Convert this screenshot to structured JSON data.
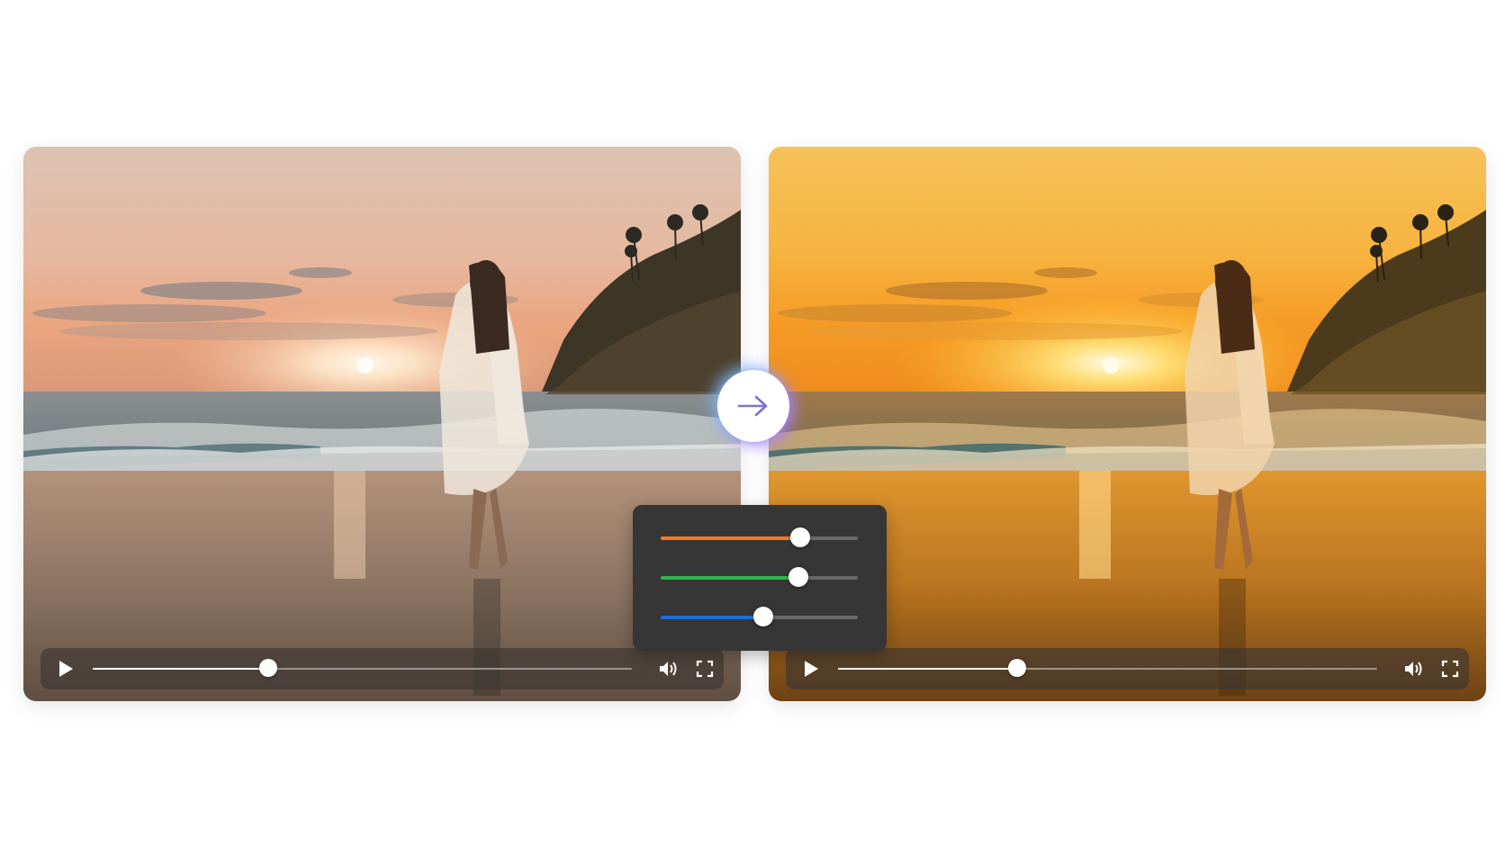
{
  "colors": {
    "accent_arrow": "#7b72d6",
    "slider_orange": "#f47a1f",
    "slider_green": "#2fb54a",
    "slider_blue": "#1d6fd8",
    "controls_bg": "#3a3632"
  },
  "before_player": {
    "progress": 0.326,
    "icons": {
      "play": "play-icon",
      "volume": "volume-icon",
      "fullscreen": "fullscreen-icon"
    }
  },
  "after_player": {
    "progress": 0.332,
    "icons": {
      "play": "play-icon",
      "volume": "volume-icon",
      "fullscreen": "fullscreen-icon"
    }
  },
  "transition": {
    "icon": "arrow-right-icon"
  },
  "adjustments": [
    {
      "name": "orange",
      "level": 0.71,
      "color": "#f47a1f"
    },
    {
      "name": "green",
      "level": 0.7,
      "color": "#2fb54a"
    },
    {
      "name": "blue",
      "level": 0.52,
      "color": "#1d6fd8"
    }
  ]
}
